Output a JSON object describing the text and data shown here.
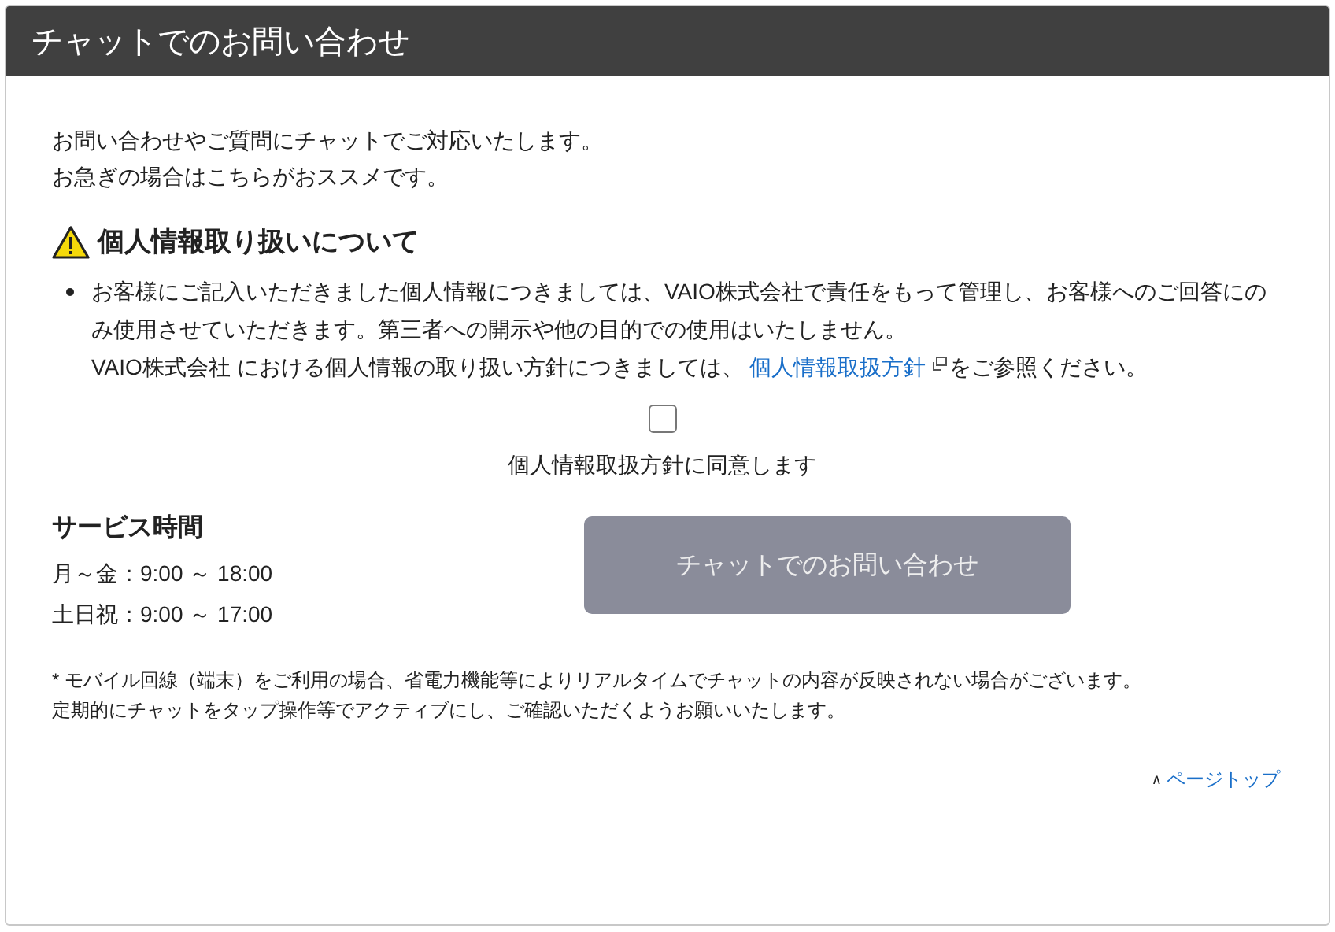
{
  "header": {
    "title": "チャットでのお問い合わせ"
  },
  "intro": [
    "お問い合わせやご質問にチャットでご対応いたします。",
    "お急ぎの場合はこちらがおススメです。"
  ],
  "privacy": {
    "heading": "個人情報取り扱いについて",
    "sentence_1": "お客様にご記入いただきました個人情報につきましては、VAIO株式会社で責任をもって管理し、お客様へのご回答にのみ使用させていただきます。第三者への開示や他の目的での使用はいたしません。",
    "sentence_2_before": "VAIO株式会社 における個人情報の取り扱い方針につきましては、 ",
    "link": "個人情報取扱方針",
    "sentence_2_after": "をご参照ください。"
  },
  "consent": {
    "label": "個人情報取扱方針に同意します",
    "checked": false
  },
  "service_hours": {
    "heading": "サービス時間",
    "rows": [
      "月～金：9:00 ～ 18:00",
      "土日祝：9:00 ～ 17:00"
    ]
  },
  "chat_button": {
    "label": "チャットでのお問い合わせ",
    "disabled": true
  },
  "notes": [
    "* モバイル回線（端末）をご利用の場合、省電力機能等によりリアルタイムでチャットの内容が反映されない場合がございます。",
    "定期的にチャットをタップ操作等でアクティブにし、ご確認いただくようお願いいたします。"
  ],
  "page_top": {
    "caret": "∧",
    "label": "ページトップ"
  }
}
